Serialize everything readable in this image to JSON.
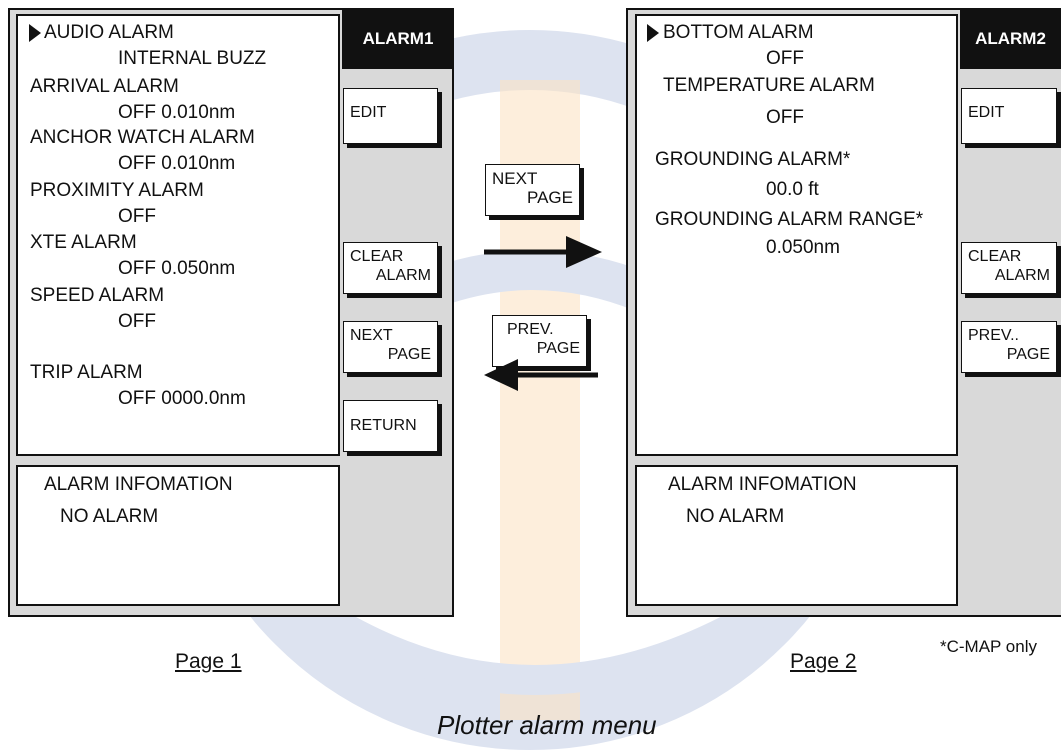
{
  "page1": {
    "header": "ALARM1",
    "items": [
      {
        "label": "AUDIO ALARM",
        "value": "INTERNAL BUZZ"
      },
      {
        "label": "ARRIVAL ALARM",
        "value": "OFF  0.010nm"
      },
      {
        "label": "ANCHOR WATCH ALARM",
        "value": "OFF  0.010nm"
      },
      {
        "label": "PROXIMITY ALARM",
        "value": "OFF"
      },
      {
        "label": "XTE ALARM",
        "value": "OFF  0.050nm"
      },
      {
        "label": "SPEED ALARM",
        "value": "OFF"
      },
      {
        "label": "TRIP ALARM",
        "value": "OFF  0000.0nm"
      }
    ],
    "info_title": "ALARM INFOMATION",
    "info_value": "NO ALARM",
    "buttons": {
      "edit": "EDIT",
      "clear_1": "CLEAR",
      "clear_2": "ALARM",
      "next_1": "NEXT",
      "next_2": "PAGE",
      "return": "RETURN"
    },
    "caption": "Page 1"
  },
  "page2": {
    "header": "ALARM2",
    "items": [
      {
        "label": "BOTTOM ALARM",
        "value": "OFF"
      },
      {
        "label": "TEMPERATURE ALARM",
        "value": "OFF"
      },
      {
        "label": "GROUNDING ALARM*",
        "value": "00.0 ft"
      },
      {
        "label": "GROUNDING ALARM RANGE*",
        "value": "0.050nm"
      }
    ],
    "info_title": "ALARM INFOMATION",
    "info_value": "NO ALARM",
    "buttons": {
      "edit": "EDIT",
      "clear_1": "CLEAR",
      "clear_2": "ALARM",
      "prev_1": "PREV..",
      "prev_2": "PAGE"
    },
    "caption": "Page 2",
    "footnote": "*C-MAP only"
  },
  "transition": {
    "next_1": "NEXT",
    "next_2": "PAGE",
    "prev_1": "PREV.",
    "prev_2": "PAGE"
  },
  "figure_title": "Plotter alarm menu",
  "colors": {
    "panel_bg": "#d9d9d9",
    "header_bg": "#111111",
    "watermark_blue": "#dde3f0",
    "watermark_orange": "#fbe3c4"
  }
}
